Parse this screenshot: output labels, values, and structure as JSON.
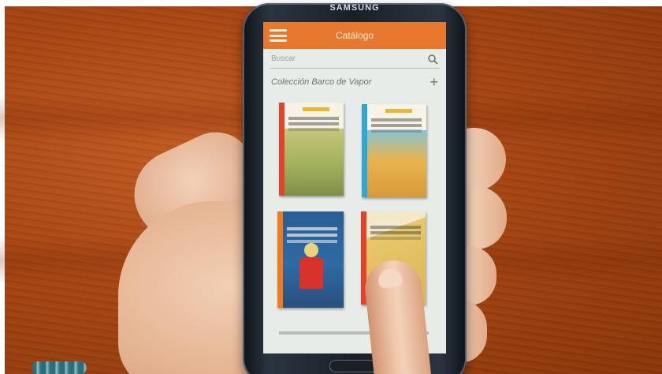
{
  "phone": {
    "brand": "SAMSUNG",
    "app_title": "Catálogo",
    "search_placeholder": "Buscar",
    "collection_title": "Colección Barco de Vapor",
    "add_symbol": "+"
  },
  "icons": [
    "menu-icon",
    "search-icon",
    "add-icon"
  ],
  "colors": {
    "appbar": "#e8782d",
    "screen_bg": "#e8ece8",
    "table_wood": "#a64512"
  },
  "books": [
    {
      "spine_color": "#e0452b"
    },
    {
      "spine_color": "#31a7cf"
    },
    {
      "spine_color": "#f07a1c"
    },
    {
      "spine_color": "#e0452b"
    }
  ]
}
